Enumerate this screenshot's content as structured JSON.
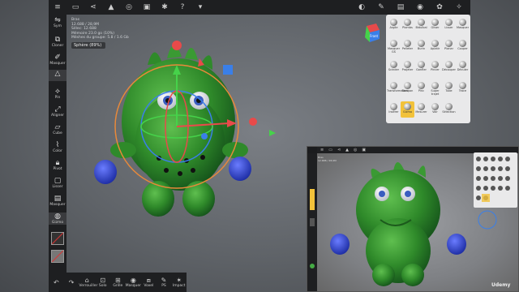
{
  "stats": {
    "lines": [
      "Bras",
      "12.688 / 28,9M",
      "Sélec: 12.688",
      "Mémoire 23.0 go (10%)",
      "Méshes du groupe: 5.8 / 1.6 Gb"
    ],
    "selected_object": "Sphère (89%)"
  },
  "toolbar": {
    "left_icons": [
      "menu-icon",
      "folder-icon",
      "share-icon",
      "scene-icon",
      "globe-icon",
      "camera-icon",
      "settings-icon",
      "help-icon",
      "dropdown-icon"
    ],
    "right_icons": [
      "color-wheel-icon",
      "brush-icon",
      "layers-icon",
      "material-icon",
      "settings-icon",
      "pin-icon"
    ]
  },
  "left_tools": [
    {
      "label": "Sym",
      "icon": "symmetry-icon"
    },
    {
      "label": "Cloner",
      "icon": "cloner-icon"
    },
    {
      "label": "Masquer",
      "icon": "hide-icon"
    },
    {
      "label": "",
      "icon": "triangle-icon"
    },
    {
      "label": "Pin",
      "icon": "pin-icon"
    },
    {
      "label": "Aligner",
      "icon": "align-icon"
    },
    {
      "label": "Cube",
      "icon": "cube-icon"
    },
    {
      "label": "Color",
      "icon": "color-icon"
    },
    {
      "label": "Pivot",
      "icon": "lock-icon"
    },
    {
      "label": "Lisser",
      "icon": "smooth-icon"
    },
    {
      "label": "Masquer",
      "icon": "mask-icon"
    },
    {
      "label": "Gizmo",
      "icon": "gizmo-icon"
    }
  ],
  "bottom_tools": [
    {
      "label": "",
      "icon": "undo-icon"
    },
    {
      "label": "",
      "icon": "redo-icon"
    },
    {
      "label": "Verrouiller",
      "icon": "lock-icon"
    },
    {
      "label": "Solo",
      "icon": "solo-icon"
    },
    {
      "label": "Grille",
      "icon": "grid-icon"
    },
    {
      "label": "Masquer",
      "icon": "eye-icon"
    },
    {
      "label": "Voxel",
      "icon": "voxel-icon"
    },
    {
      "label": "PS",
      "icon": "ps-icon"
    },
    {
      "label": "Impact",
      "icon": "impact-icon"
    }
  ],
  "brush_panel": {
    "rows": [
      [
        "Argile",
        "Plombs",
        "Bidulbal",
        "Gliser",
        "Lisser",
        "Masquer"
      ],
      [
        "Masquer GS",
        "Pelleter",
        "Burin",
        "Aplatir",
        "Planar",
        "Couper"
      ],
      [
        "Scinder",
        "Projeter",
        "Gonfler",
        "Pincer",
        "Découper",
        "Déculer"
      ],
      [
        "Transformation",
        "Tampon",
        "Pinc",
        "Super trajet",
        "Tube",
        "Trace"
      ],
      [
        "Insérer",
        "Gizmo",
        "Mesurer",
        "Voir",
        "Sélection"
      ]
    ],
    "selected": "Gizmo"
  },
  "cube_gizmo": {
    "label": "Front"
  },
  "watermark": "Udemy",
  "inset": {
    "stats_lines": [
      "Bras",
      "12.688 / 28,9M"
    ]
  }
}
